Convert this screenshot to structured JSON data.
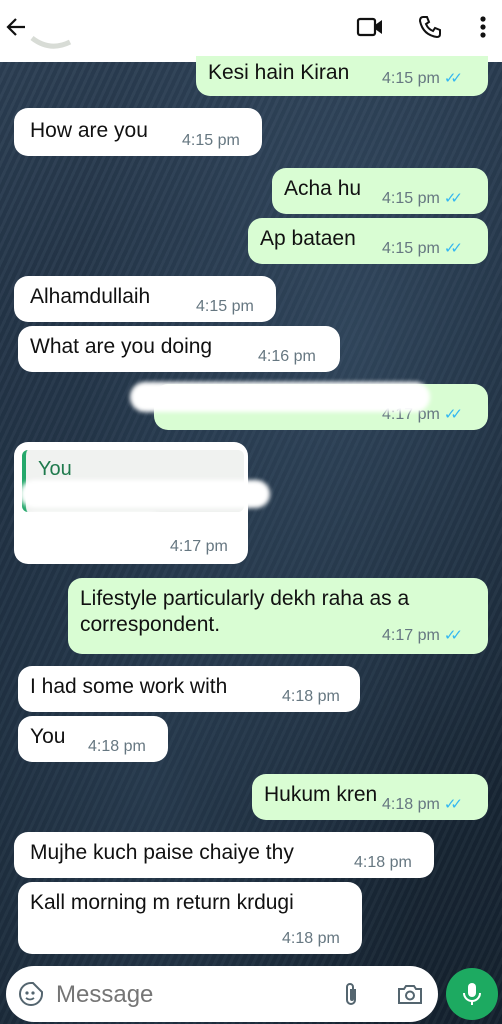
{
  "header": {
    "contact_name": "",
    "icons": [
      "back-arrow-icon",
      "video-call-icon",
      "phone-icon",
      "more-vert-icon"
    ]
  },
  "messages": [
    {
      "dir": "out",
      "text": "Kesi hain Kiran",
      "time": "4:15 pm"
    },
    {
      "dir": "in",
      "text": "How are you",
      "time": "4:15 pm"
    },
    {
      "dir": "out",
      "text": "Acha hu",
      "time": "4:15 pm"
    },
    {
      "dir": "out",
      "text": "Ap bataen",
      "time": "4:15 pm"
    },
    {
      "dir": "in",
      "text": "Alhamdullaih",
      "time": "4:15 pm"
    },
    {
      "dir": "in",
      "text": "What are you doing",
      "time": "4:16 pm"
    },
    {
      "dir": "out",
      "text": "",
      "time": "4:17 pm"
    },
    {
      "dir": "in",
      "reply_to": "You",
      "text": "",
      "time": "4:17 pm"
    },
    {
      "dir": "out",
      "text": "Lifestyle particularly dekh raha as a correspondent.",
      "time": "4:17 pm"
    },
    {
      "dir": "in",
      "text": "I had some work with",
      "time": "4:18 pm"
    },
    {
      "dir": "in",
      "text": "You",
      "time": "4:18 pm"
    },
    {
      "dir": "out",
      "text": "Hukum kren",
      "time": "4:18 pm"
    },
    {
      "dir": "in",
      "text": "Mujhe kuch paise chaiye thy",
      "time": "4:18 pm"
    },
    {
      "dir": "in",
      "text": "Kall morning m return krdugi",
      "time": "4:18 pm"
    }
  ],
  "composer": {
    "placeholder": "Message",
    "icons": [
      "emoji-sticker-icon",
      "attach-icon",
      "camera-icon",
      "mic-icon"
    ]
  },
  "colors": {
    "outgoing_bubble": "#d9fdd3",
    "incoming_bubble": "#ffffff",
    "read_tick": "#34b7f1",
    "mic_button": "#1daa61"
  }
}
